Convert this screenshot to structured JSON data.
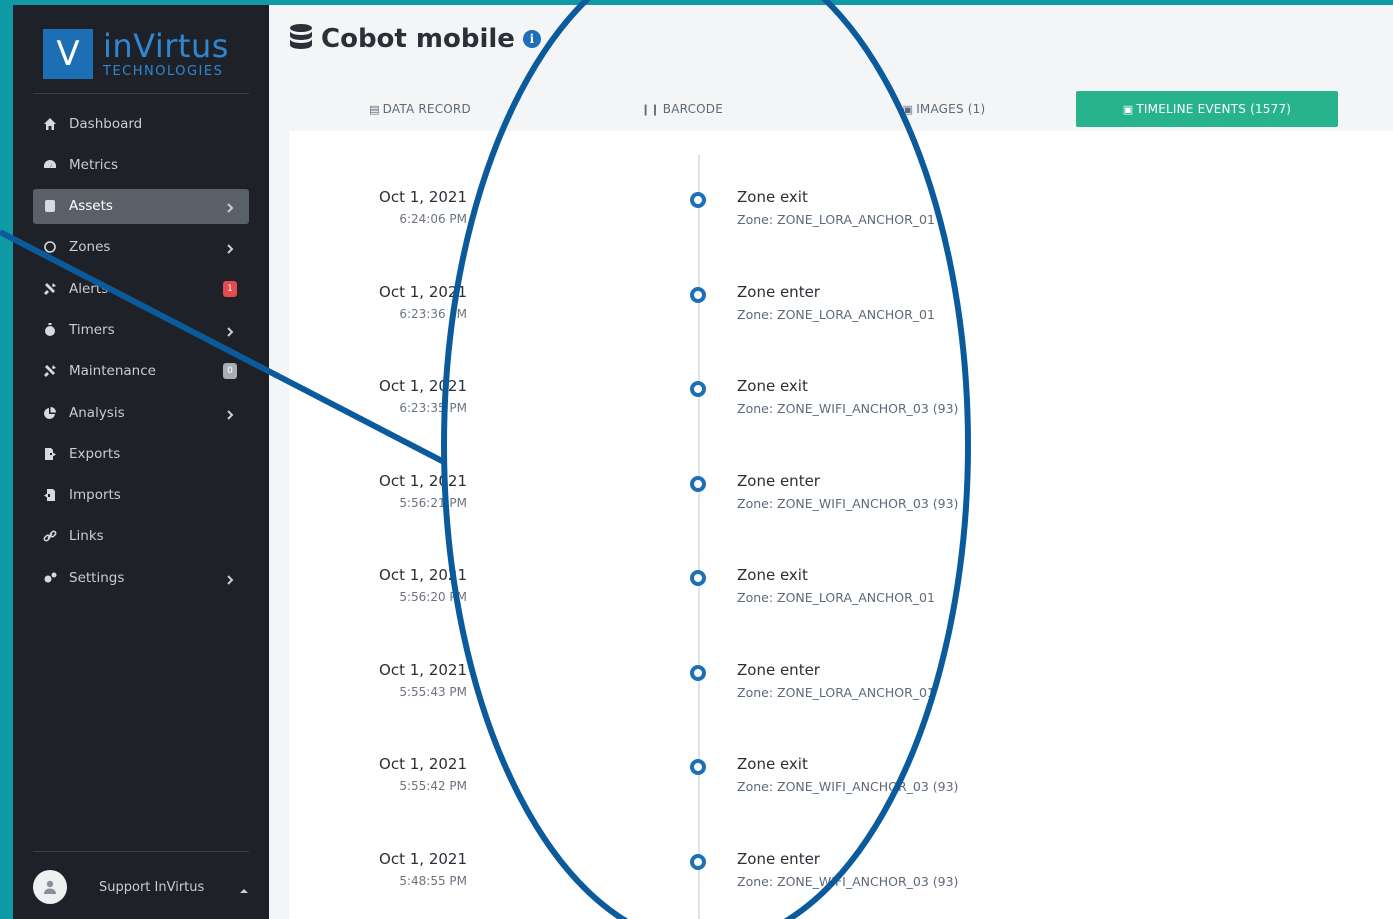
{
  "brand": {
    "logo_letter": "V",
    "name": "inVirtus",
    "subtitle": "TECHNOLOGIES"
  },
  "sidebar": {
    "items": [
      {
        "label": "Dashboard",
        "icon": "home-icon",
        "chevron": false
      },
      {
        "label": "Metrics",
        "icon": "gauge-icon",
        "chevron": false
      },
      {
        "label": "Assets",
        "icon": "database-icon",
        "chevron": true,
        "active": true
      },
      {
        "label": "Zones",
        "icon": "circle-icon",
        "chevron": true
      },
      {
        "label": "Alerts",
        "icon": "tools-icon",
        "badge": "1",
        "badge_color": "#e5484d"
      },
      {
        "label": "Timers",
        "icon": "stopwatch-icon",
        "chevron": true
      },
      {
        "label": "Maintenance",
        "icon": "tools-icon",
        "badge": "0",
        "badge_color": "#a9aeb5"
      },
      {
        "label": "Analysis",
        "icon": "pie-chart-icon",
        "chevron": true
      },
      {
        "label": "Exports",
        "icon": "file-export-icon",
        "chevron": false
      },
      {
        "label": "Imports",
        "icon": "file-import-icon",
        "chevron": false
      },
      {
        "label": "Links",
        "icon": "link-icon",
        "chevron": false
      },
      {
        "label": "Settings",
        "icon": "cogs-icon",
        "chevron": true
      }
    ],
    "user": {
      "name": "Support InVirtus"
    }
  },
  "page": {
    "title": "Cobot mobile",
    "info_glyph": "i"
  },
  "tabs": [
    {
      "label": "DATA RECORD",
      "icon": "database-icon"
    },
    {
      "label": "BARCODE",
      "icon": "barcode-icon"
    },
    {
      "label": "IMAGES (1)",
      "icon": "image-icon"
    },
    {
      "label": "TIMELINE EVENTS (1577)",
      "icon": "calendar-icon",
      "active": true
    }
  ],
  "timeline": [
    {
      "date": "Oct 1, 2021",
      "time": "6:24:06 PM",
      "title": "Zone exit",
      "desc": "Zone: ZONE_LORA_ANCHOR_01"
    },
    {
      "date": "Oct 1, 2021",
      "time": "6:23:36 PM",
      "title": "Zone enter",
      "desc": "Zone: ZONE_LORA_ANCHOR_01"
    },
    {
      "date": "Oct 1, 2021",
      "time": "6:23:35 PM",
      "title": "Zone exit",
      "desc": "Zone: ZONE_WIFI_ANCHOR_03 (93)"
    },
    {
      "date": "Oct 1, 2021",
      "time": "5:56:21 PM",
      "title": "Zone enter",
      "desc": "Zone: ZONE_WIFI_ANCHOR_03 (93)"
    },
    {
      "date": "Oct 1, 2021",
      "time": "5:56:20 PM",
      "title": "Zone exit",
      "desc": "Zone: ZONE_LORA_ANCHOR_01"
    },
    {
      "date": "Oct 1, 2021",
      "time": "5:55:43 PM",
      "title": "Zone enter",
      "desc": "Zone: ZONE_LORA_ANCHOR_01"
    },
    {
      "date": "Oct 1, 2021",
      "time": "5:55:42 PM",
      "title": "Zone exit",
      "desc": "Zone: ZONE_WIFI_ANCHOR_03 (93)"
    },
    {
      "date": "Oct 1, 2021",
      "time": "5:48:55 PM",
      "title": "Zone enter",
      "desc": "Zone: ZONE_WIFI_ANCHOR_03 (93)"
    }
  ],
  "colors": {
    "accent_tab": "#27b48c",
    "timeline_dot": "#1d6fb8",
    "annotation": "#0b5b9c",
    "background": "#0f9aa6"
  }
}
